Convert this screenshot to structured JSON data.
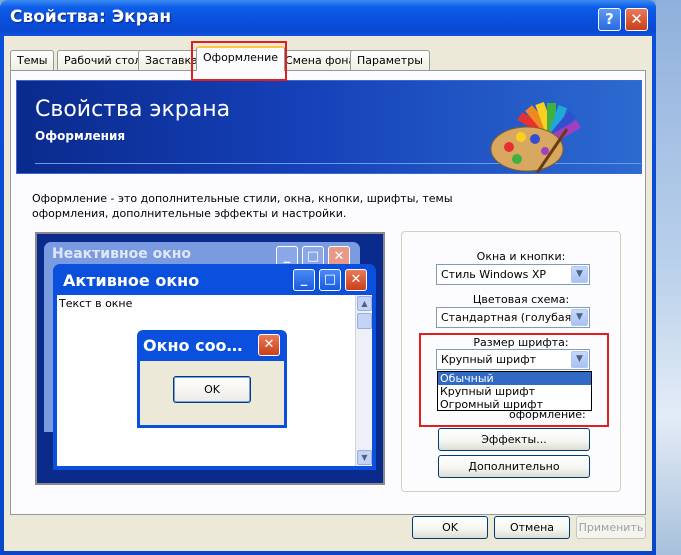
{
  "window": {
    "title": "Свойства: Экран",
    "help_label": "?",
    "close_label": "✕"
  },
  "tabs": [
    {
      "label": "Темы"
    },
    {
      "label": "Рабочий стол"
    },
    {
      "label": "Заставка"
    },
    {
      "label": "Оформление",
      "active": true
    },
    {
      "label": "Смена фона"
    },
    {
      "label": "Параметры"
    }
  ],
  "banner": {
    "title": "Свойства экрана",
    "subtitle": "Оформления"
  },
  "description": "Оформление - это дополнительные стили, окна, кнопки, шрифты, темы оформления, дополнительные эффекты и настройки.",
  "preview": {
    "inactive_title": "Неактивное окно",
    "active_title": "Активное окно",
    "window_text": "Текст в окне",
    "message_title": "Окно соо…",
    "ok_label": "OK"
  },
  "settings": {
    "windows_buttons_label": "Окна и кнопки:",
    "windows_buttons_value": "Стиль Windows XP",
    "color_scheme_label": "Цветовая схема:",
    "color_scheme_value": "Стандартная (голубая)",
    "font_size_label": "Размер шрифта:",
    "font_size_value": "Крупный шрифт",
    "font_size_options": [
      "Обычный",
      "Крупный шрифт",
      "Огромный шрифт"
    ],
    "hidden_label_tail": "оформление:",
    "effects_label": "Эффекты...",
    "advanced_label": "Дополнительно"
  },
  "footer": {
    "ok_label": "OK",
    "cancel_label": "Отмена",
    "apply_label": "Применить"
  },
  "colors": {
    "title_blue": "#0a50dc",
    "highlight_red": "#e02020",
    "selection_blue": "#316ac5"
  }
}
